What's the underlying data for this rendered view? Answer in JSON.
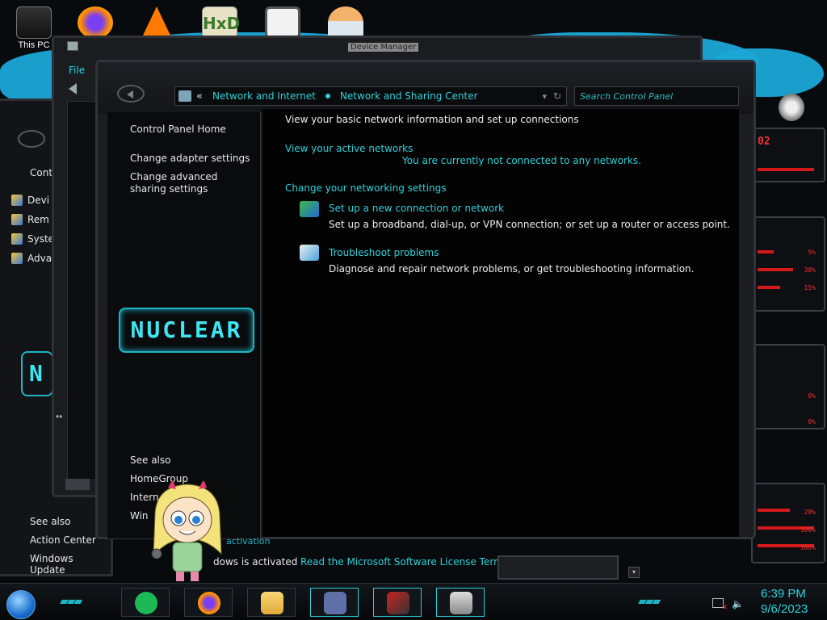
{
  "desktop": {
    "icons": [
      {
        "label": "This PC",
        "name": "this-pc"
      },
      {
        "label": "",
        "name": "firefox"
      },
      {
        "label": "",
        "name": "vlc"
      },
      {
        "label": "",
        "name": "hxd"
      },
      {
        "label": "",
        "name": "app-maze"
      },
      {
        "label": "",
        "name": "user-profile"
      }
    ]
  },
  "device_manager": {
    "title": "Device Manager",
    "menu": {
      "file": "File"
    }
  },
  "back_window": {
    "items": [
      {
        "label": "Devi"
      },
      {
        "label": "Rem"
      },
      {
        "label": "Syste"
      },
      {
        "label": "Adva"
      }
    ],
    "top_link": "Cont",
    "see_also": "See also",
    "links": [
      "Action Center",
      "Windows Update"
    ]
  },
  "control_panel": {
    "breadcrumb": {
      "chevron": "«",
      "items": [
        "Network and Internet",
        "Network and Sharing Center"
      ]
    },
    "search": {
      "placeholder": "Search Control Panel"
    },
    "left": {
      "home": "Control Panel Home",
      "links": [
        "Change adapter settings",
        "Change advanced sharing settings"
      ],
      "logo": "NUCLEAR",
      "see_also": "See also",
      "see_also_links": [
        "HomeGroup",
        "Intern",
        "Win"
      ]
    },
    "main": {
      "heading": "View your basic network information and set up connections",
      "active_networks": "View your active networks",
      "not_connected": "You are currently not connected to any networks.",
      "change_settings": "Change your networking settings",
      "tasks": [
        {
          "title": "Set up a new connection or network",
          "desc": "Set up a broadband, dial-up, or VPN connection; or set up a router or access point."
        },
        {
          "title": "Troubleshoot problems",
          "desc": "Diagnose and repair network problems, or get troubleshooting information."
        }
      ]
    }
  },
  "activation": {
    "partial_heading": "activation",
    "status": "dows is activated",
    "license_link": "Read the Microsoft Software License Terms"
  },
  "gadgets": {
    "counter": "02",
    "percents": [
      "5%",
      "38%",
      "15%",
      "0%",
      "0%",
      "28%",
      "100%",
      "100%"
    ]
  },
  "taskbar": {
    "apps": [
      "spotify",
      "firefox",
      "file-explorer",
      "control-panel",
      "network-center",
      "device-manager"
    ],
    "clock": {
      "time": "6:39 PM",
      "date": "9/6/2023"
    }
  },
  "colors": {
    "accent": "#2fd0d8",
    "alert": "#d41a1a"
  }
}
